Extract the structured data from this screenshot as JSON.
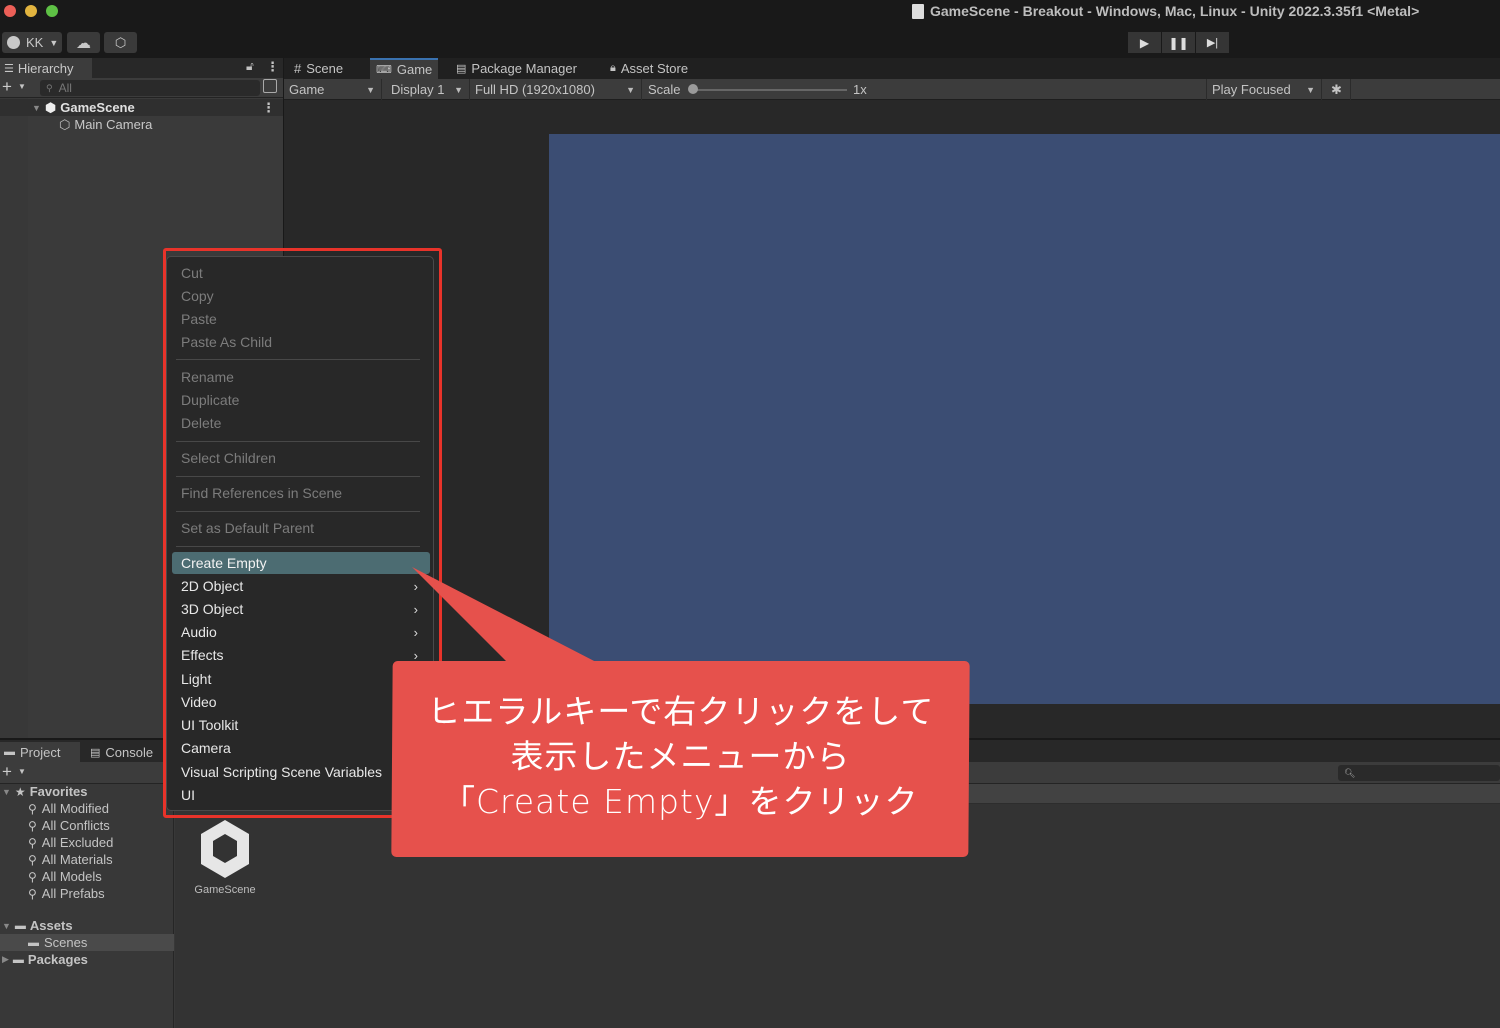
{
  "window": {
    "title": "GameScene - Breakout - Windows, Mac, Linux - Unity 2022.3.35f1 <Metal>",
    "traffic_lights": {
      "close": "#ec5f57",
      "minimize": "#e2b43f",
      "maximize": "#5ec145"
    }
  },
  "toolbar": {
    "account_label": "KK",
    "account_icon": "user-circle-icon",
    "cloud_icon": "cloud-icon",
    "services_icon": "unity-services-icon",
    "play_icon": "play-icon",
    "pause_icon": "pause-icon",
    "step_icon": "step-icon"
  },
  "hierarchy": {
    "tab_label": "Hierarchy",
    "search_placeholder": "All",
    "scene_name": "GameScene",
    "children": [
      "Main Camera"
    ]
  },
  "game_view": {
    "tabs": [
      {
        "label": "Scene",
        "icon": "hash-icon"
      },
      {
        "label": "Game",
        "icon": "gamepad-icon",
        "active": true
      },
      {
        "label": "Package Manager",
        "icon": "package-icon"
      },
      {
        "label": "Asset Store",
        "icon": "shopping-bag-icon"
      }
    ],
    "controls": {
      "view_mode": "Game",
      "display": "Display 1",
      "resolution": "Full HD (1920x1080)",
      "scale_label": "Scale",
      "scale_value": "1x",
      "play_mode": "Play Focused"
    },
    "viewport_color": "#3b4d73"
  },
  "context_menu": {
    "groups": [
      [
        {
          "label": "Cut",
          "disabled": true
        },
        {
          "label": "Copy",
          "disabled": true
        },
        {
          "label": "Paste",
          "disabled": true
        },
        {
          "label": "Paste As Child",
          "disabled": true
        }
      ],
      [
        {
          "label": "Rename",
          "disabled": true
        },
        {
          "label": "Duplicate",
          "disabled": true
        },
        {
          "label": "Delete",
          "disabled": true
        }
      ],
      [
        {
          "label": "Select Children",
          "disabled": true
        }
      ],
      [
        {
          "label": "Find References in Scene",
          "disabled": true
        }
      ],
      [
        {
          "label": "Set as Default Parent",
          "disabled": true
        }
      ],
      [
        {
          "label": "Create Empty",
          "highlighted": true
        },
        {
          "label": "2D Object",
          "submenu": true
        },
        {
          "label": "3D Object",
          "submenu": true
        },
        {
          "label": "Audio",
          "submenu": true
        },
        {
          "label": "Effects",
          "submenu": true
        },
        {
          "label": "Light"
        },
        {
          "label": "Video"
        },
        {
          "label": "UI Toolkit"
        },
        {
          "label": "Camera"
        },
        {
          "label": "Visual Scripting Scene Variables"
        },
        {
          "label": "UI"
        }
      ]
    ],
    "highlight_frame_color": "#e8332a"
  },
  "callout": {
    "lines": [
      "ヒエラルキーで右クリックをして",
      "表示したメニューから",
      "「Create Empty」をクリック"
    ],
    "color": "#e6514c"
  },
  "project": {
    "tabs": [
      {
        "label": "Project",
        "icon": "folder-icon"
      },
      {
        "label": "Console",
        "icon": "console-icon"
      }
    ],
    "favorites_label": "Favorites",
    "favorites": [
      "All Modified",
      "All Conflicts",
      "All Excluded",
      "All Materials",
      "All Models",
      "All Prefabs"
    ],
    "assets_label": "Assets",
    "asset_folders": [
      "Scenes"
    ],
    "packages_label": "Packages",
    "content_items": [
      {
        "label": "GameScene",
        "icon": "unity-scene-icon"
      }
    ]
  }
}
